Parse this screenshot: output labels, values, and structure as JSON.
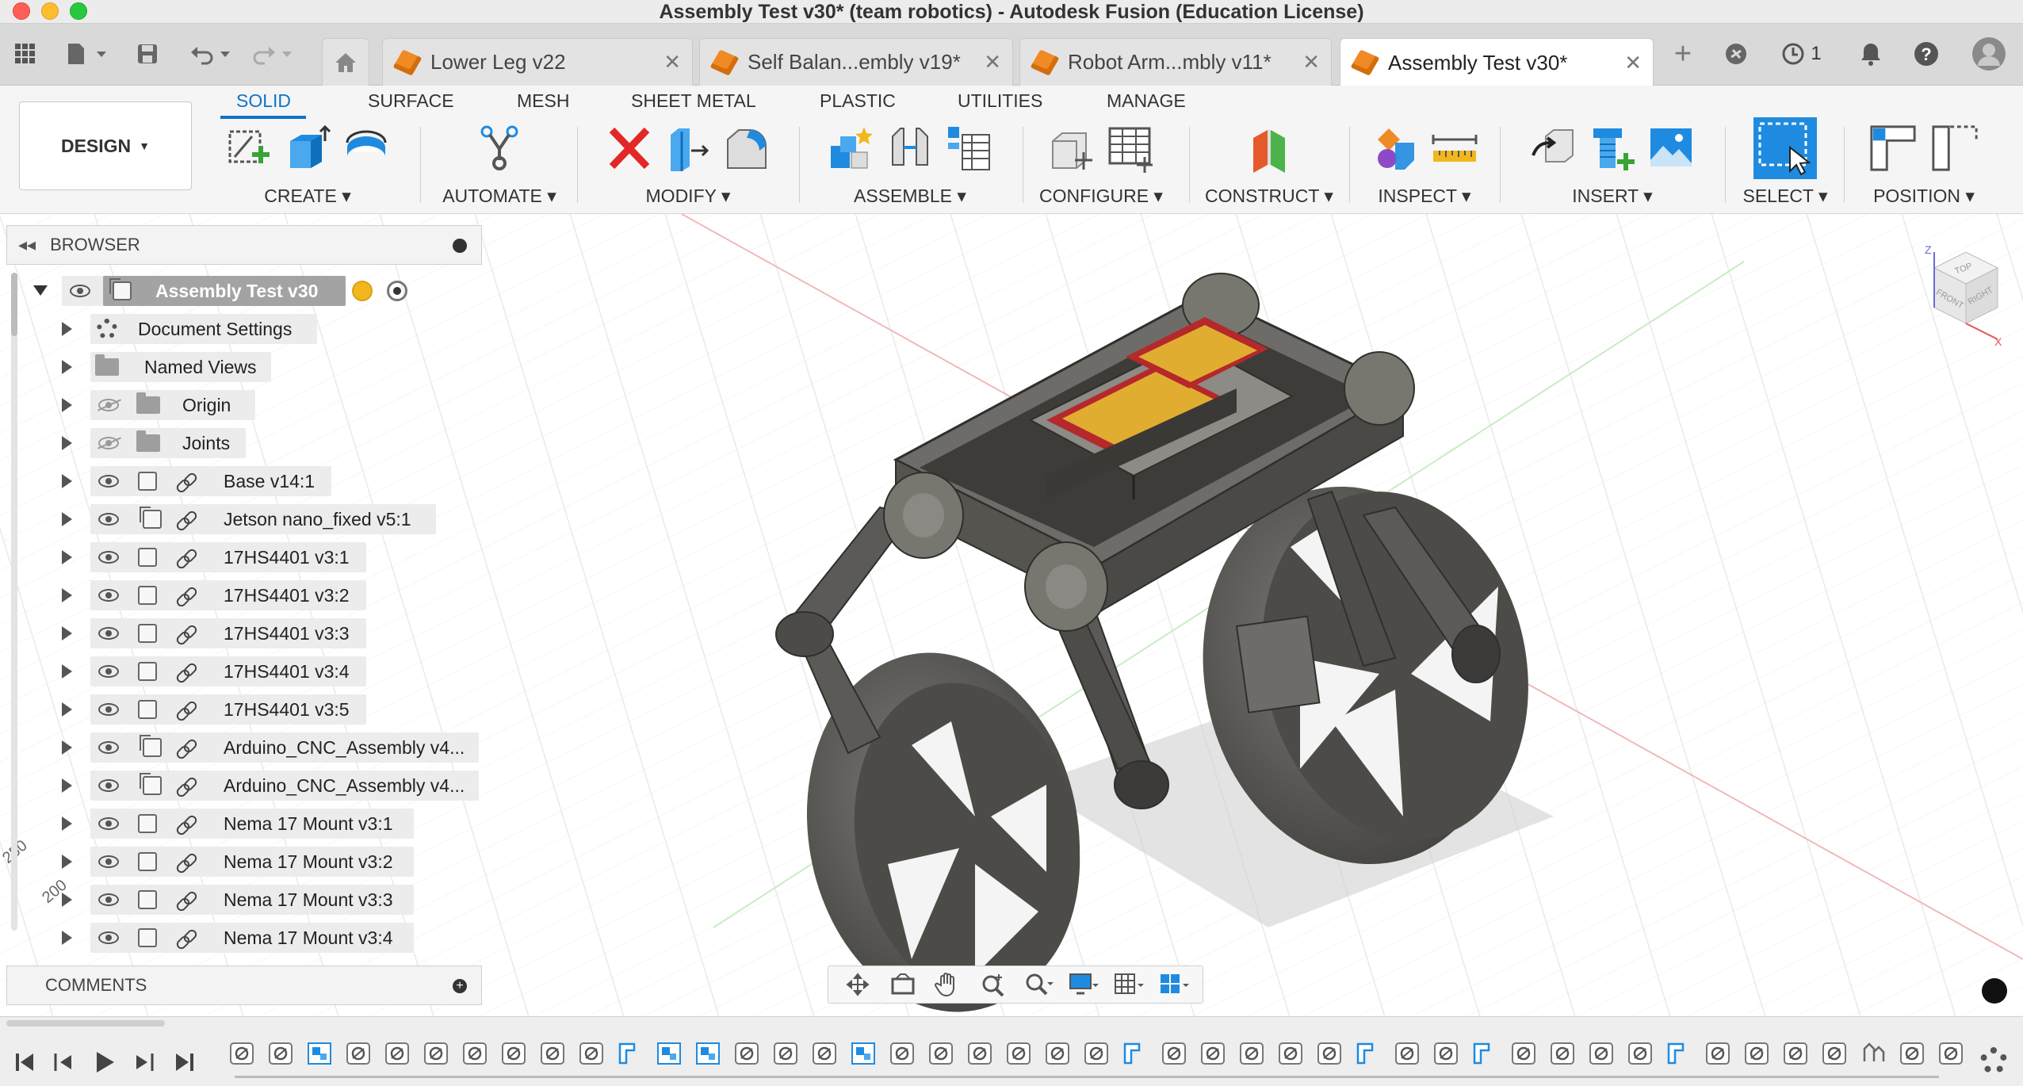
{
  "window": {
    "title": "Assembly Test v30* (team robotics) - Autodesk Fusion (Education License)"
  },
  "tabs": [
    {
      "label": "Lower Leg v22",
      "active": false
    },
    {
      "label": "Self Balan...embly v19*",
      "active": false
    },
    {
      "label": "Robot Arm...mbly v11*",
      "active": false
    },
    {
      "label": "Assembly Test v30*",
      "active": true
    }
  ],
  "header_right": {
    "job_count": "1"
  },
  "toolbar": {
    "workspace": "DESIGN",
    "workspace_tabs": [
      "SOLID",
      "SURFACE",
      "MESH",
      "SHEET METAL",
      "PLASTIC",
      "UTILITIES",
      "MANAGE"
    ],
    "groups": [
      "CREATE",
      "AUTOMATE",
      "MODIFY",
      "ASSEMBLE",
      "CONFIGURE",
      "CONSTRUCT",
      "INSPECT",
      "INSERT",
      "SELECT",
      "POSITION"
    ]
  },
  "browser": {
    "title": "BROWSER",
    "root": "Assembly Test v30",
    "items": [
      {
        "label": "Document Settings",
        "icon": "gear-icon"
      },
      {
        "label": "Named Views",
        "icon": "folder-icon"
      },
      {
        "label": "Origin",
        "icon": "folder-icon",
        "hidden": true
      },
      {
        "label": "Joints",
        "icon": "folder-icon",
        "hidden": true
      },
      {
        "label": "Base v14:1",
        "icon": "component-icon"
      },
      {
        "label": "Jetson nano_fixed v5:1",
        "icon": "component-icon"
      },
      {
        "label": "17HS4401 v3:1",
        "icon": "component-icon"
      },
      {
        "label": "17HS4401 v3:2",
        "icon": "component-icon"
      },
      {
        "label": "17HS4401 v3:3",
        "icon": "component-icon"
      },
      {
        "label": "17HS4401 v3:4",
        "icon": "component-icon"
      },
      {
        "label": "17HS4401 v3:5",
        "icon": "component-icon"
      },
      {
        "label": "Arduino_CNC_Assembly v4...",
        "icon": "component-icon"
      },
      {
        "label": "Arduino_CNC_Assembly v4...",
        "icon": "component-icon"
      },
      {
        "label": "Nema 17 Mount v3:1",
        "icon": "component-icon"
      },
      {
        "label": "Nema 17 Mount v3:2",
        "icon": "component-icon"
      },
      {
        "label": "Nema 17 Mount v3:3",
        "icon": "component-icon"
      },
      {
        "label": "Nema 17 Mount v3:4",
        "icon": "component-icon"
      }
    ]
  },
  "comments": {
    "title": "COMMENTS"
  },
  "viewcube": {
    "top": "TOP",
    "front": "FRONT",
    "right": "RIGHT",
    "axis_z": "Z",
    "axis_x": "X"
  },
  "grid_labels": [
    "250",
    "200"
  ],
  "colors": {
    "accent": "#0f74c9",
    "tab_cube": "#f08a24",
    "delete_red": "#e32626",
    "model_gray": "#5b5a57",
    "pcb_red": "#b5282b",
    "pcb_yellow": "#e8c431"
  }
}
